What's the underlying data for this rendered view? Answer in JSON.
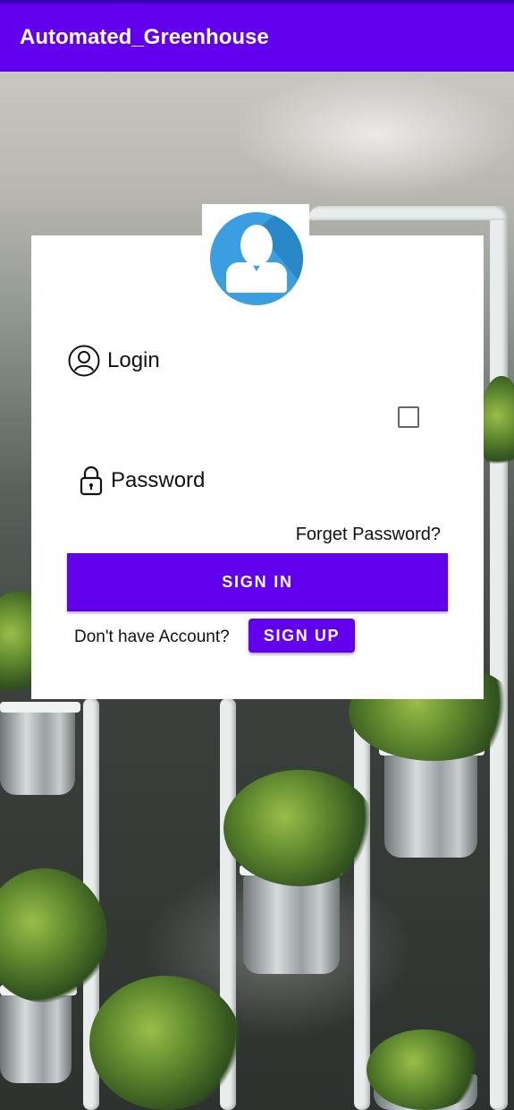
{
  "app_bar": {
    "title": "Automated_Greenhouse"
  },
  "login_form": {
    "login_label": "Login",
    "password_label": "Password",
    "forget_password": "Forget Password?",
    "sign_in_label": "SIGN IN",
    "no_account_text": "Don't have Account?",
    "sign_up_label": "SIGN UP",
    "remember_checked": false
  },
  "colors": {
    "primary": "#6200ee",
    "status_bar": "#3700b3",
    "avatar": "#3a9ee0"
  },
  "icons": {
    "avatar": "user-avatar-icon",
    "login": "account-circle-icon",
    "password": "lock-icon"
  }
}
